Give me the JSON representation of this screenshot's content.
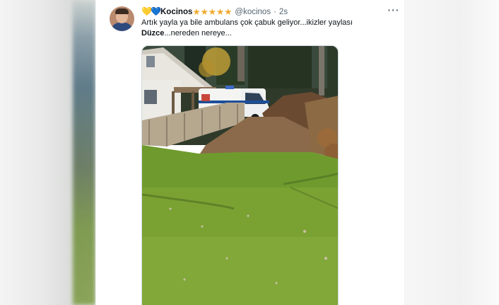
{
  "tweet": {
    "name": "Kocinos",
    "name_badges": {
      "heart1": "💛",
      "heart2": "💙",
      "stars": "★★★★★"
    },
    "handle": "@kocinos",
    "separator": "·",
    "time": "2s",
    "more_icon": "more-horizontal-icon",
    "text_line1": "Artık yayla ya bile ambulans çok çabuk geliyor...ikizler yaylası",
    "text_line2_bold": "Düzce",
    "text_line2_rest": "...nereden nereye...",
    "colors": {
      "text_primary": "#0f1419",
      "text_secondary": "#536471",
      "star": "#f0a92e",
      "heart_yellow": "#f6c343",
      "heart_blue": "#5aa7e0"
    }
  },
  "photo": {
    "description_icon": "photo-attachment"
  }
}
